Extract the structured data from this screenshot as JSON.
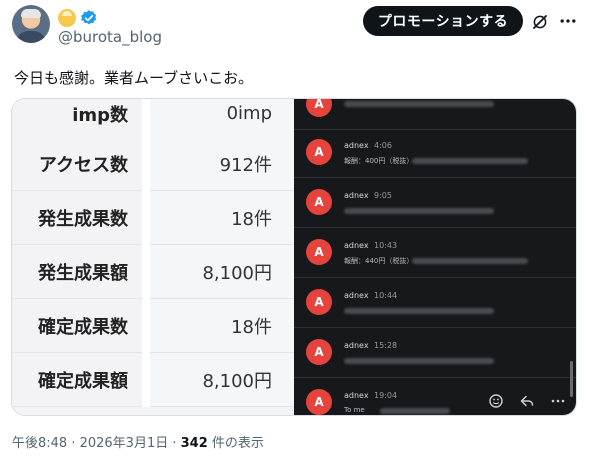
{
  "header": {
    "handle": "@burota_blog",
    "promo_label": "プロモーションする",
    "icons": [
      "avatar",
      "face-emoji-icon",
      "verified-icon",
      "grok-icon",
      "more-icon"
    ]
  },
  "tweet": {
    "text": "今日も感謝。業者ムーブさいこお。"
  },
  "media": {
    "stats": [
      {
        "label": "imp数",
        "value": "0imp"
      },
      {
        "label": "アクセス数",
        "value": "912件"
      },
      {
        "label": "発生成果数",
        "value": "18件"
      },
      {
        "label": "発生成果額",
        "value": "8,100円"
      },
      {
        "label": "確定成果数",
        "value": "18件"
      },
      {
        "label": "確定成果額",
        "value": "8,100円"
      }
    ],
    "mail": [
      {
        "avatar": "A",
        "sender": "",
        "time": "",
        "preview": ""
      },
      {
        "avatar": "A",
        "sender": "adnex",
        "time": "4:06",
        "preview": "報酬：400円（税抜）"
      },
      {
        "avatar": "A",
        "sender": "adnex",
        "time": "9:05",
        "preview": ""
      },
      {
        "avatar": "A",
        "sender": "adnex",
        "time": "10:43",
        "preview": "報酬：440円（税抜）"
      },
      {
        "avatar": "A",
        "sender": "adnex",
        "time": "10:44",
        "preview": ""
      },
      {
        "avatar": "A",
        "sender": "adnex",
        "time": "15:28",
        "preview": ""
      },
      {
        "avatar": "A",
        "sender": "adnex",
        "time": "19:04",
        "preview": "To me"
      }
    ]
  },
  "footer": {
    "timestamp": "午後8:48 · 2026年3月1日 · ",
    "views_count": "342",
    "views_suffix": " 件の表示"
  },
  "colors": {
    "promo_bg": "#0f1419",
    "mail_avatar": "#e5433b",
    "mail_bg": "#17181b",
    "verified": "#1d9bf0"
  }
}
